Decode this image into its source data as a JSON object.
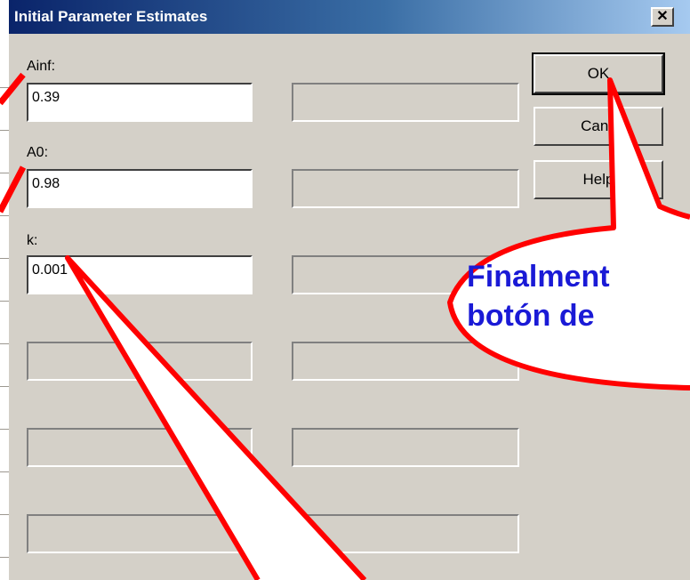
{
  "dialog": {
    "title": "Initial Parameter Estimates",
    "close_glyph": "✕"
  },
  "params": [
    {
      "label": "Ainf:",
      "value": "0.39"
    },
    {
      "label": "A0:",
      "value": "0.98"
    },
    {
      "label": "k:",
      "value": "0.001"
    }
  ],
  "buttons": {
    "ok": "OK",
    "cancel": "Canc",
    "help": "Help"
  },
  "callout": {
    "line1": "Finalment",
    "line2": "botón de"
  },
  "colors": {
    "dialog_bg": "#d4d0c8",
    "title_start": "#0a246a",
    "title_end": "#a6caf0",
    "annotation_red": "#ff0000",
    "callout_text": "#1a1ad6"
  }
}
